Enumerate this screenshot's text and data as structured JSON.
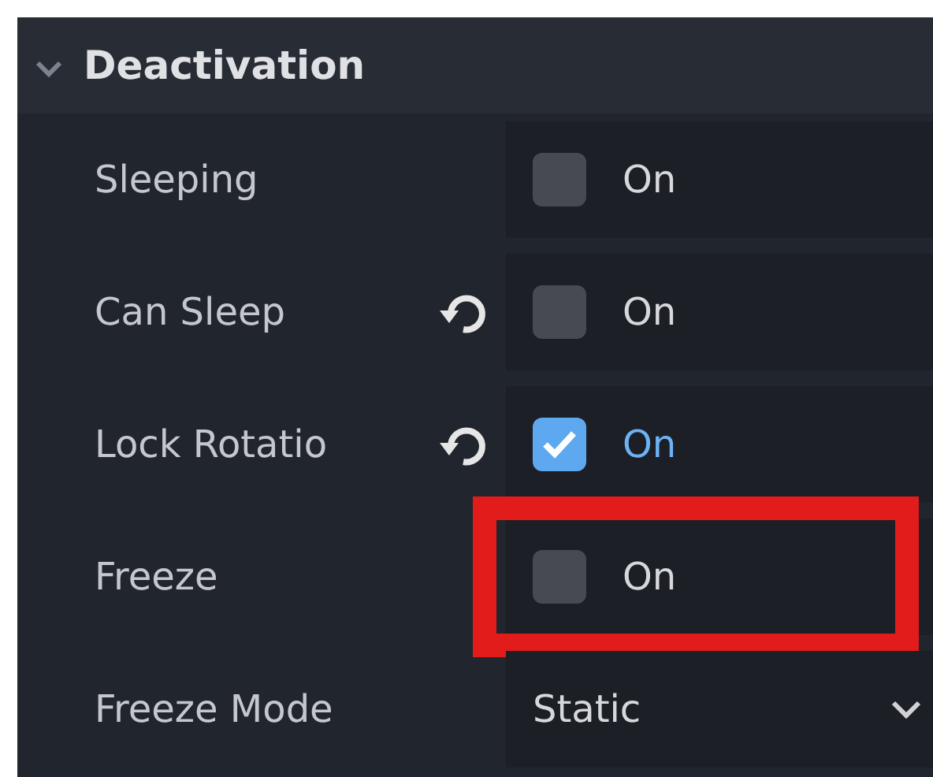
{
  "section": {
    "title": "Deactivation",
    "expanded": true
  },
  "properties": [
    {
      "label": "Sleeping",
      "kind": "checkbox",
      "revertable": false,
      "checked": false,
      "value": "On",
      "highlighted": false
    },
    {
      "label": "Can Sleep",
      "kind": "checkbox",
      "revertable": true,
      "checked": false,
      "value": "On",
      "highlighted": false
    },
    {
      "label": "Lock Rotatio",
      "kind": "checkbox",
      "revertable": true,
      "checked": true,
      "value": "On",
      "highlighted": false
    },
    {
      "label": "Freeze",
      "kind": "checkbox",
      "revertable": false,
      "checked": false,
      "value": "On",
      "highlighted": true
    },
    {
      "label": "Freeze Mode",
      "kind": "dropdown",
      "revertable": false,
      "value": "Static",
      "highlighted": false
    }
  ]
}
